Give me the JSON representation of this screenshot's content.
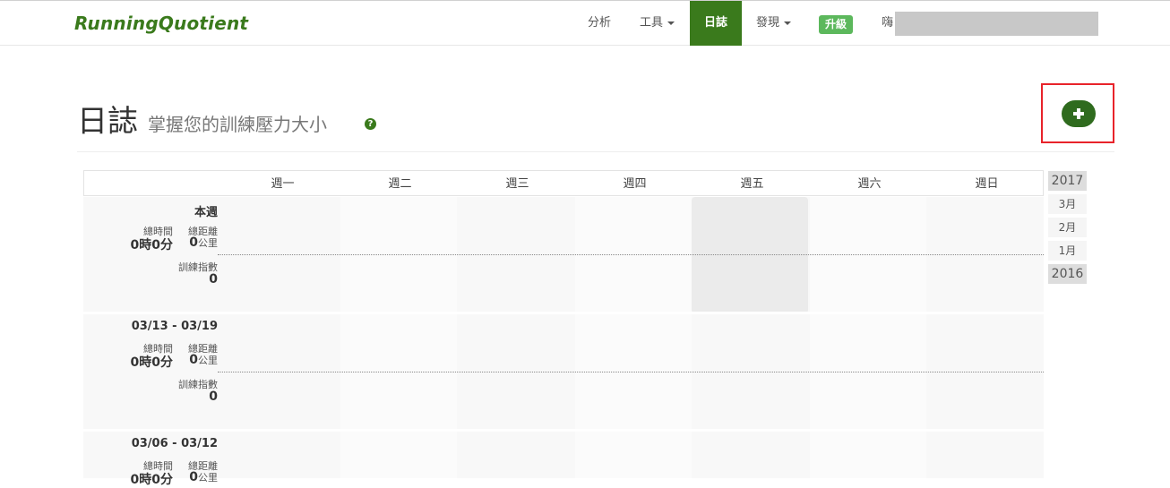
{
  "nav": {
    "brand": "RunningQuotient",
    "items": [
      {
        "label": "分析"
      },
      {
        "label": "工具"
      },
      {
        "label": "日誌"
      },
      {
        "label": "發現"
      }
    ],
    "upgrade": "升級",
    "greeting": "嗨",
    "active_color": "#3a7a1c"
  },
  "header": {
    "title": "日誌",
    "subtitle": "掌握您的訓練壓力大小",
    "help_glyph": "?",
    "add_icon": "plus-icon"
  },
  "calendar": {
    "days": [
      "週一",
      "週二",
      "週三",
      "週四",
      "週五",
      "週六",
      "週日"
    ],
    "weeks": [
      {
        "title": "本週",
        "time_label": "總時間",
        "dist_label": "總距離",
        "time_value": "0時0分",
        "dist_value": "0",
        "dist_unit": "公里",
        "index_label": "訓練指數",
        "index_value": "0"
      },
      {
        "title": "03/13 - 03/19",
        "time_label": "總時間",
        "dist_label": "總距離",
        "time_value": "0時0分",
        "dist_value": "0",
        "dist_unit": "公里",
        "index_label": "訓練指數",
        "index_value": "0"
      },
      {
        "title": "03/06 - 03/12",
        "time_label": "總時間",
        "dist_label": "總距離",
        "time_value": "0時0分",
        "dist_value": "0",
        "dist_unit": "公里"
      }
    ]
  },
  "side_nav": {
    "items": [
      "2017",
      "3月",
      "2月",
      "1月",
      "2016"
    ]
  }
}
